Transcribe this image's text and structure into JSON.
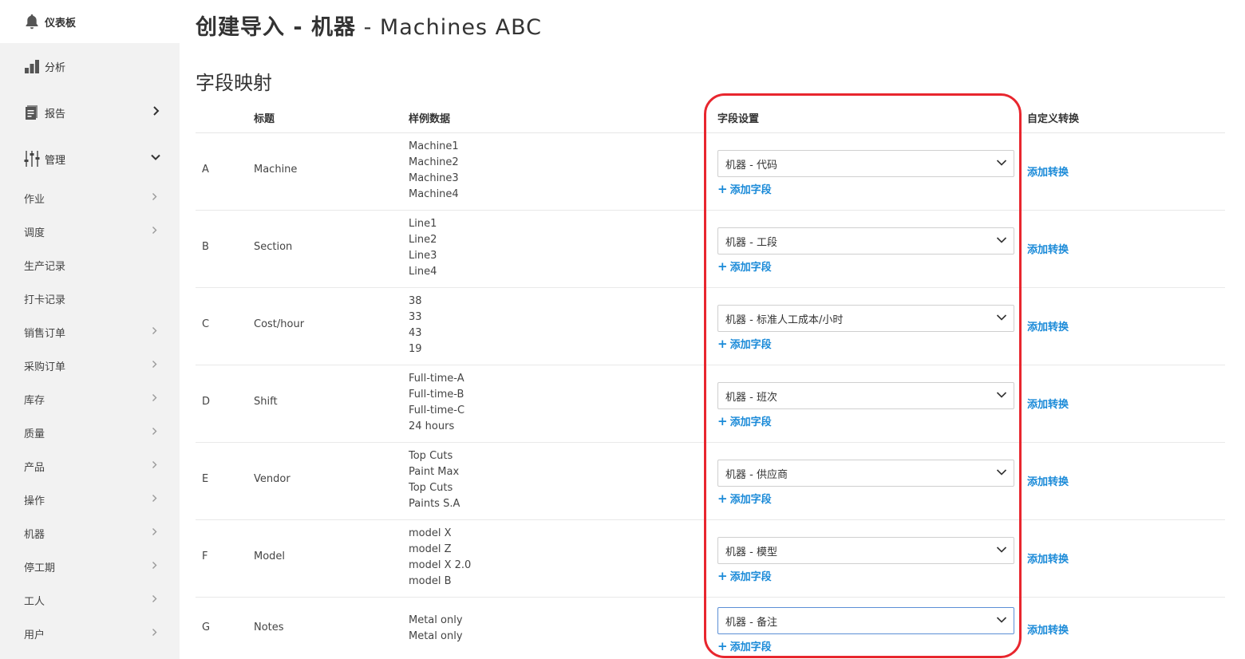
{
  "sidebar": {
    "dashboard": "仪表板",
    "analysis": "分析",
    "reports": "报告",
    "manage": "管理",
    "sub_items": [
      {
        "label": "作业",
        "has_arrow": true
      },
      {
        "label": "调度",
        "has_arrow": true
      },
      {
        "label": "生产记录",
        "has_arrow": false
      },
      {
        "label": "打卡记录",
        "has_arrow": false
      },
      {
        "label": "销售订单",
        "has_arrow": true
      },
      {
        "label": "采购订单",
        "has_arrow": true
      },
      {
        "label": "库存",
        "has_arrow": true
      },
      {
        "label": "质量",
        "has_arrow": true
      },
      {
        "label": "产品",
        "has_arrow": true
      },
      {
        "label": "操作",
        "has_arrow": true
      },
      {
        "label": "机器",
        "has_arrow": true
      },
      {
        "label": "停工期",
        "has_arrow": true
      },
      {
        "label": "工人",
        "has_arrow": true
      },
      {
        "label": "用户",
        "has_arrow": true
      }
    ]
  },
  "page": {
    "title_bold": "创建导入 - 机器",
    "title_rest": " - Machines ABC",
    "section_title": "字段映射"
  },
  "table": {
    "headers": {
      "title": "标题",
      "sample": "样例数据",
      "field_setting": "字段设置",
      "custom_transform": "自定义转换"
    },
    "add_field_label": "添加字段",
    "add_transform_label": "添加转换",
    "rows": [
      {
        "letter": "A",
        "title": "Machine",
        "samples": [
          "Machine1",
          "Machine2",
          "Machine3",
          "Machine4"
        ],
        "field": "机器 - 代码"
      },
      {
        "letter": "B",
        "title": "Section",
        "samples": [
          "Line1",
          "Line2",
          "Line3",
          "Line4"
        ],
        "field": "机器 - 工段"
      },
      {
        "letter": "C",
        "title": "Cost/hour",
        "samples": [
          "38",
          "33",
          "43",
          "19"
        ],
        "field": "机器 - 标准人工成本/小时"
      },
      {
        "letter": "D",
        "title": "Shift",
        "samples": [
          "Full-time-A",
          "Full-time-B",
          "Full-time-C",
          "24 hours"
        ],
        "field": "机器 - 班次"
      },
      {
        "letter": "E",
        "title": "Vendor",
        "samples": [
          "Top Cuts",
          "Paint Max",
          "Top Cuts",
          "Paints S.A"
        ],
        "field": "机器 - 供应商"
      },
      {
        "letter": "F",
        "title": "Model",
        "samples": [
          "model X",
          "model Z",
          "model X 2.0",
          "model B"
        ],
        "field": "机器 - 模型"
      },
      {
        "letter": "G",
        "title": "Notes",
        "samples": [
          "Metal only",
          "Metal only"
        ],
        "field": "机器 - 备注"
      }
    ]
  },
  "colors": {
    "link": "#1a8ad8",
    "highlight": "#e8262e",
    "sidebar_bg": "#f2f2f2"
  }
}
